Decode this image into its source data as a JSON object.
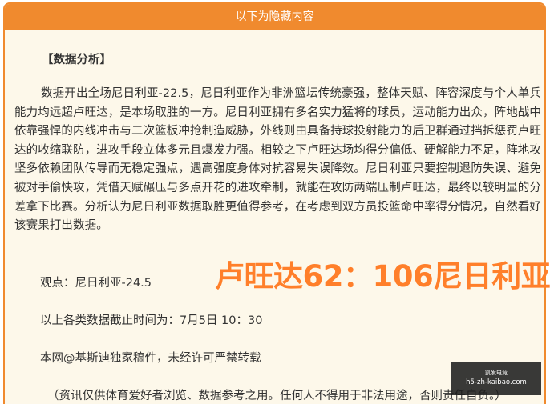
{
  "header": {
    "title": "以下为隐藏内容"
  },
  "article": {
    "section_title": "【数据分析】",
    "body": "数据开出全场尼日利亚-22.5，尼日利亚作为非洲篮坛传统豪强，整体天赋、阵容深度与个人单兵能力均远超卢旺达，是本场取胜的一方。尼日利亚拥有多名实力猛将的球员，运动能力出众，阵地战中依靠强悍的内线冲击与二次篮板冲抢制造威胁，外线则由具备持球投射能力的后卫群通过挡拆惩罚卢旺达的收缩联防，进攻手段立体多元且爆发力强。相较之下卢旺达场均得分偏低、硬解能力不足，阵地攻坚多依赖团队传导而无稳定强点，遇高强度身体对抗容易失误降效。尼日利亚只要控制退防失误、避免被对手偷快攻，凭借天赋碾压与多点开花的进攻牵制，就能在攻防两端压制卢旺达，最终以较明显的分差拿下比赛。分析认为尼日利亚数据取胜更值得参考，在考虑到双方员投篮命中率得分情况，自然看好该赛果打出数据。",
    "viewpoint": "观点：尼日利亚-24.5",
    "data_time": "以上各类数据截止时间为：7月5日 10：30",
    "copyright": "本网@基斯迪独家稿件，未经许可严禁转载",
    "disclaimer": "（资讯仅供体育爱好者浏览、数据参考之用。任何人不得用于非法用途，否则责任自负。）"
  },
  "overlay": {
    "score_text": "卢旺达62：106尼日利亚"
  },
  "watermark": {
    "logo_text": "凯发电竞",
    "url": "h5-zh-kaibao.com"
  },
  "colors": {
    "accent": "#f08a2e",
    "panel_bg": "#fdf8ea",
    "score_text": "#ff7f2a",
    "body_text": "#333333"
  }
}
